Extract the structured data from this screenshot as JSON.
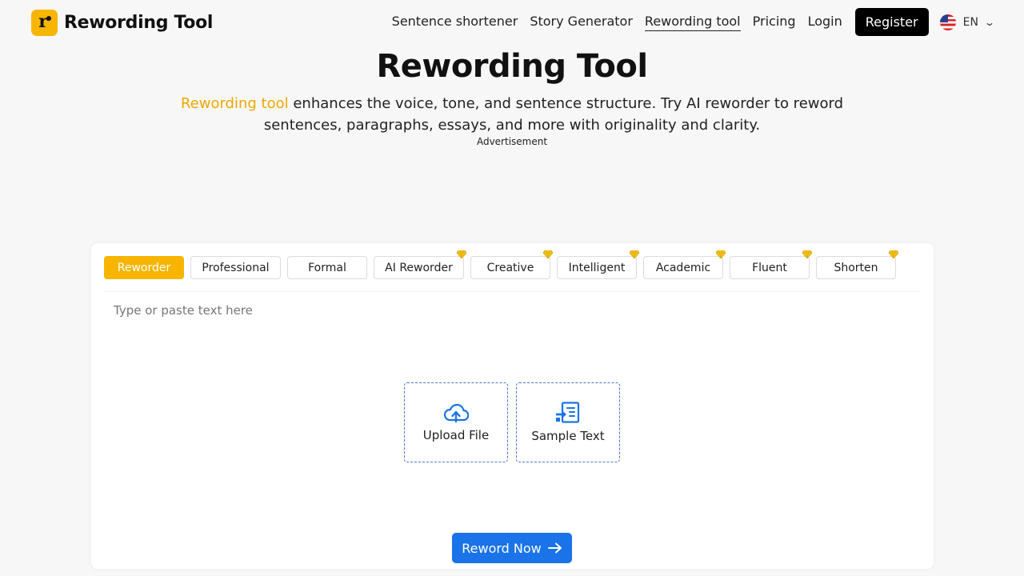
{
  "header": {
    "logo_text": "Rewording Tool",
    "nav": [
      {
        "label": "Sentence shortener",
        "active": false
      },
      {
        "label": "Story Generator",
        "active": false
      },
      {
        "label": "Rewording tool",
        "active": true
      },
      {
        "label": "Pricing",
        "active": false
      },
      {
        "label": "Login",
        "active": false
      }
    ],
    "register_label": "Register",
    "language": {
      "code": "EN",
      "flag_icon": "us-flag-icon"
    }
  },
  "hero": {
    "title": "Rewording Tool",
    "subtitle_accent": "Rewording tool",
    "subtitle_rest": " enhances the voice, tone, and sentence structure. Try AI reworder to reword sentences, paragraphs, essays, and more with originality and clarity.",
    "ad_label": "Advertisement"
  },
  "modes": [
    {
      "label": "Reworder",
      "active": true,
      "premium": false
    },
    {
      "label": "Professional",
      "active": false,
      "premium": false
    },
    {
      "label": "Formal",
      "active": false,
      "premium": false
    },
    {
      "label": "AI Reworder",
      "active": false,
      "premium": true
    },
    {
      "label": "Creative",
      "active": false,
      "premium": true
    },
    {
      "label": "Intelligent",
      "active": false,
      "premium": true
    },
    {
      "label": "Academic",
      "active": false,
      "premium": true
    },
    {
      "label": "Fluent",
      "active": false,
      "premium": true
    },
    {
      "label": "Shorten",
      "active": false,
      "premium": true
    }
  ],
  "editor": {
    "placeholder": "Type or paste text here",
    "value": ""
  },
  "tiles": {
    "upload_label": "Upload File",
    "sample_label": "Sample Text"
  },
  "actions": {
    "reword_label": "Reword Now"
  },
  "colors": {
    "brand_yellow": "#f7b500",
    "accent_text": "#f0a800",
    "primary_blue": "#1a73e8",
    "premium_gem": "#f5c518"
  }
}
